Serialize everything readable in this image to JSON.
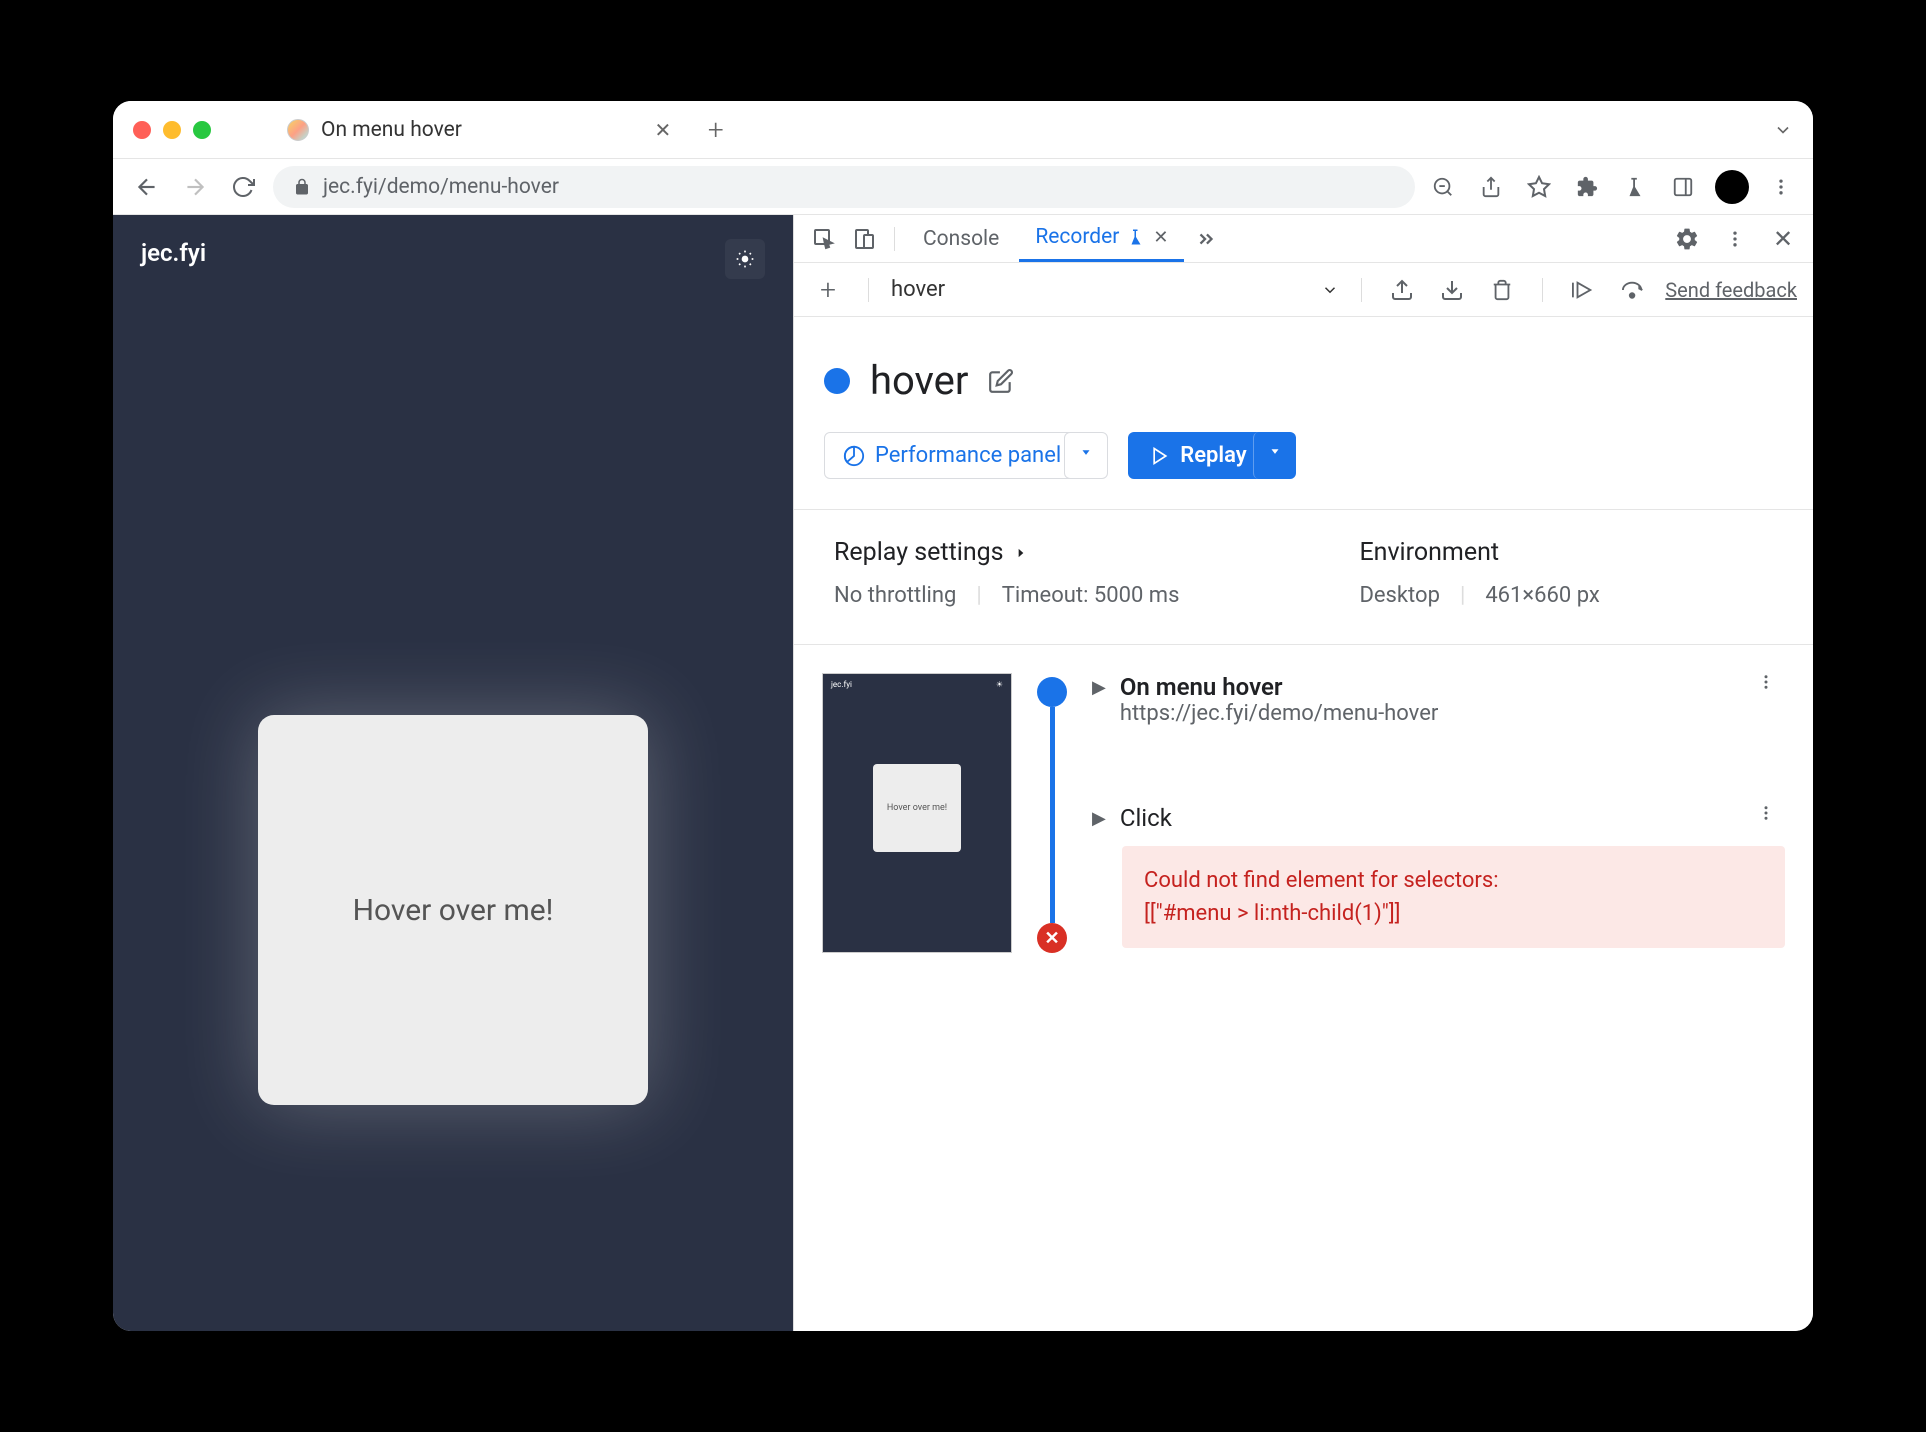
{
  "browser": {
    "tab_title": "On menu hover",
    "url": "jec.fyi/demo/menu-hover"
  },
  "webpage": {
    "site_title": "jec.fyi",
    "hover_text": "Hover over me!"
  },
  "devtools": {
    "tabs": {
      "console": "Console",
      "recorder": "Recorder"
    },
    "recorder": {
      "dropdown_name": "hover",
      "feedback": "Send feedback",
      "title": "hover",
      "perf_label": "Performance panel",
      "replay_label": "Replay",
      "settings": {
        "replay_heading": "Replay settings",
        "throttling": "No throttling",
        "timeout": "Timeout: 5000 ms",
        "env_heading": "Environment",
        "device": "Desktop",
        "dimensions": "461×660 px"
      },
      "steps": {
        "thumb_site": "jec.fyi",
        "thumb_hover": "Hover over me!",
        "step1_title": "On menu hover",
        "step1_url": "https://jec.fyi/demo/menu-hover",
        "step2_title": "Click",
        "error_line1": "Could not find element for selectors:",
        "error_line2": "[[\"#menu > li:nth-child(1)\"]]"
      }
    }
  }
}
